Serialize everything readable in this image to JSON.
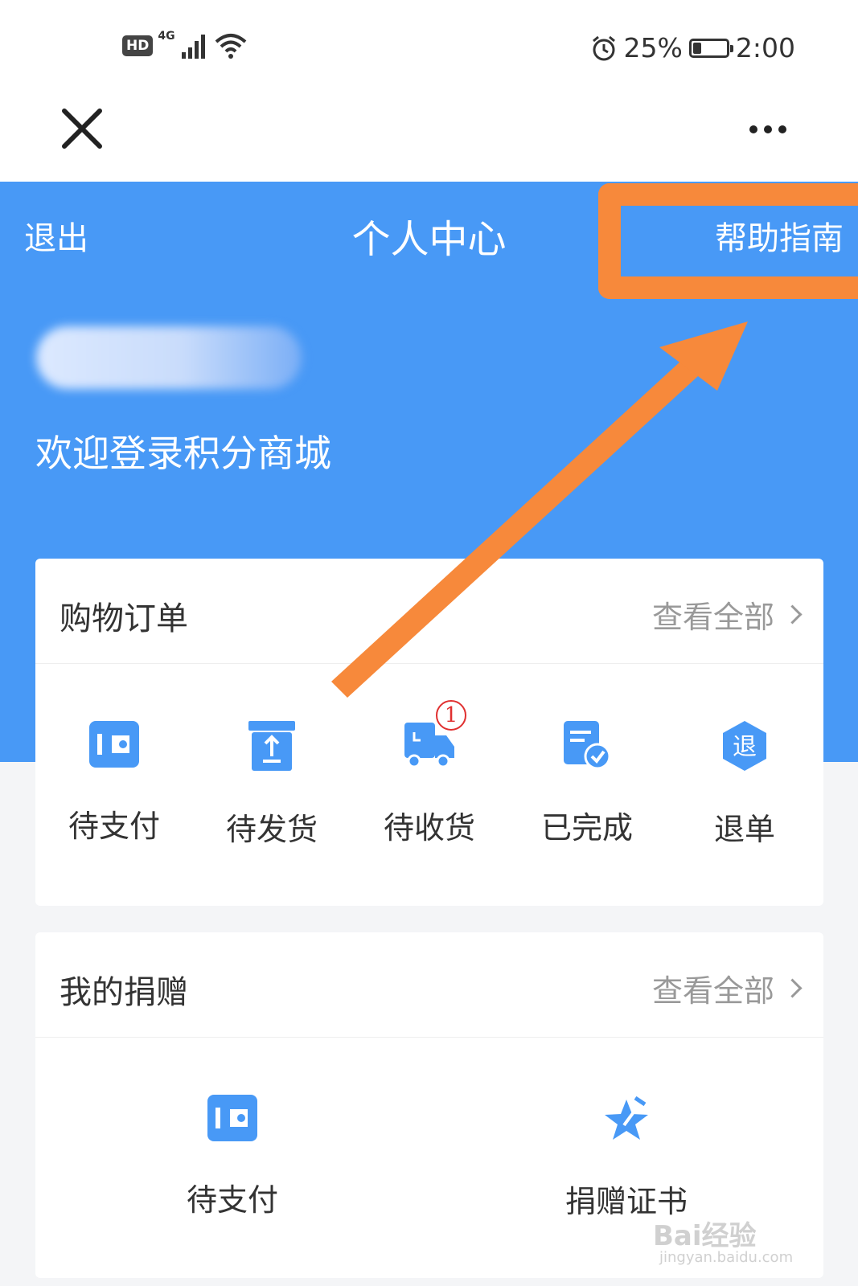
{
  "status_bar": {
    "hd": "HD",
    "network": "4G",
    "battery_percent": "25%",
    "battery_level": 0.25,
    "time": "2:00"
  },
  "nav": {
    "close_icon": "close-icon",
    "more_icon": "more-dots-icon"
  },
  "header": {
    "logout": "退出",
    "title": "个人中心",
    "help": "帮助指南",
    "welcome": "欢迎登录积分商城",
    "accent_color": "#4899f6",
    "highlight_color": "#f7893b"
  },
  "orders": {
    "title": "购物订单",
    "view_all": "查看全部",
    "items": [
      {
        "label": "待支付",
        "icon": "wallet-icon"
      },
      {
        "label": "待发货",
        "icon": "package-icon"
      },
      {
        "label": "待收货",
        "icon": "truck-icon",
        "badge": "1"
      },
      {
        "label": "已完成",
        "icon": "completed-doc-icon"
      },
      {
        "label": "退单",
        "icon": "refund-icon",
        "glyph": "退"
      }
    ]
  },
  "donations": {
    "title": "我的捐赠",
    "view_all": "查看全部",
    "items": [
      {
        "label": "待支付",
        "icon": "wallet-icon"
      },
      {
        "label": "捐赠证书",
        "icon": "star-certificate-icon"
      }
    ]
  },
  "watermark": {
    "brand": "Bai经验",
    "url": "jingyan.baidu.com"
  }
}
